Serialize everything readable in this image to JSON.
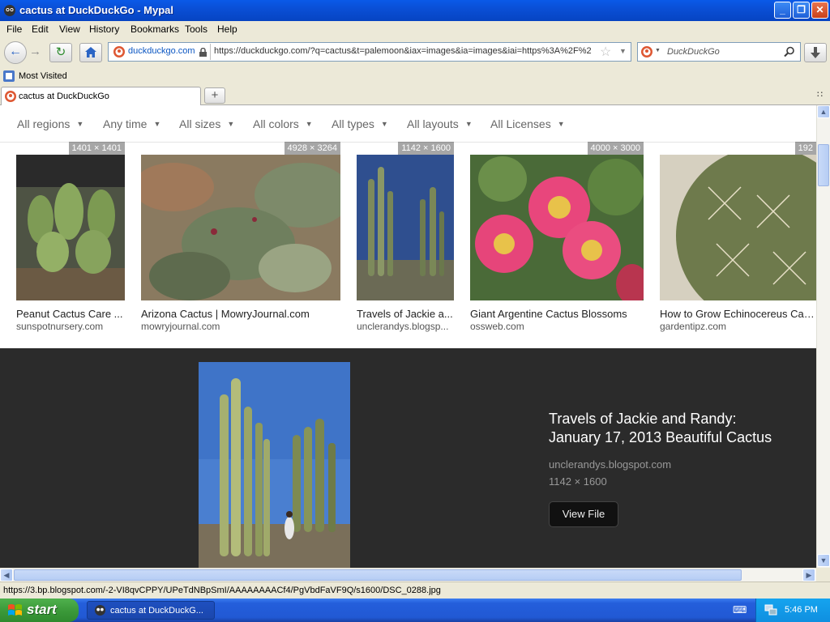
{
  "window": {
    "title": "cactus at DuckDuckGo - Mypal",
    "minimize": "_",
    "maximize": "❐",
    "close": "✕"
  },
  "menu": [
    "File",
    "Edit",
    "View",
    "History",
    "Bookmarks",
    "Tools",
    "Help"
  ],
  "nav": {
    "identity": "duckduckgo.com",
    "url": "https://duckduckgo.com/?q=cactus&t=palemoon&iax=images&ia=images&iai=https%3A%2F%2",
    "search_placeholder": "DuckDuckGo"
  },
  "bookmarks": {
    "most_visited": "Most Visited"
  },
  "tabs": [
    {
      "label": "cactus at DuckDuckGo"
    }
  ],
  "filters": [
    "All regions",
    "Any time",
    "All sizes",
    "All colors",
    "All types",
    "All layouts",
    "All Licenses"
  ],
  "results": [
    {
      "caption": "Peanut Cactus Care ...",
      "source": "sunspotnursery.com",
      "dims": "1401 × 1401"
    },
    {
      "caption": "Arizona Cactus | MowryJournal.com",
      "source": "mowryjournal.com",
      "dims": "4928 × 3264"
    },
    {
      "caption": "Travels of Jackie a...",
      "source": "unclerandys.blogsp...",
      "dims": "1142 × 1600"
    },
    {
      "caption": "Giant Argentine Cactus Blossoms",
      "source": "ossweb.com",
      "dims": "4000 × 3000"
    },
    {
      "caption": "How to Grow Echinocereus Cactus",
      "source": "gardentipz.com",
      "dims": "192"
    }
  ],
  "detail": {
    "title": "Travels of Jackie and Randy: January 17, 2013 Beautiful Cactus",
    "site": "unclerandys.blogspot.com",
    "dims": "1142 × 1600",
    "button": "View File"
  },
  "status": "https://3.bp.blogspot.com/-2-VI8qvCPPY/UPeTdNBpSmI/AAAAAAAACf4/PgVbdFaVF9Q/s1600/DSC_0288.jpg",
  "taskbar": {
    "start": "start",
    "item": "cactus at DuckDuckG...",
    "clock": "5:46 PM"
  },
  "colors": {
    "titlebar": "#0a5ae8",
    "taskbar": "#245edb",
    "start": "#3c9a3a",
    "detail_bg": "#2b2b2b"
  }
}
